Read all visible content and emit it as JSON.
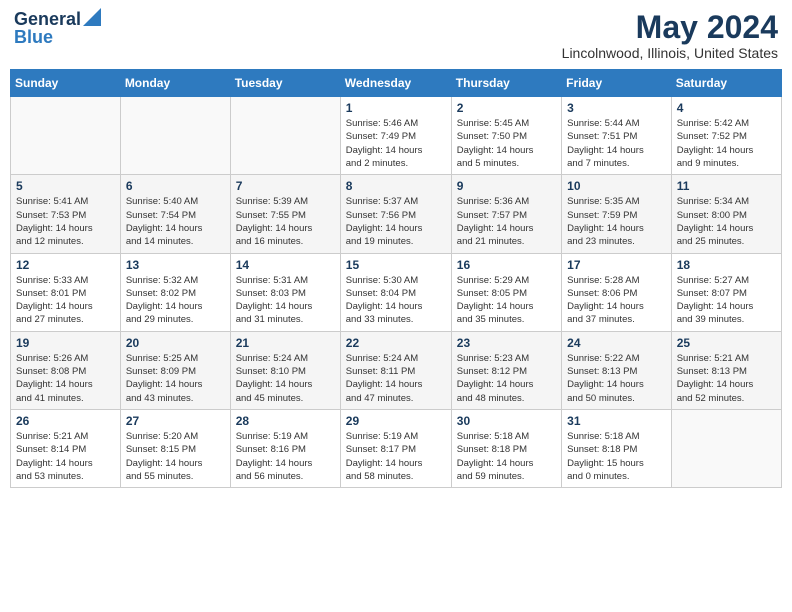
{
  "header": {
    "logo_general": "General",
    "logo_blue": "Blue",
    "month": "May 2024",
    "location": "Lincolnwood, Illinois, United States"
  },
  "days_of_week": [
    "Sunday",
    "Monday",
    "Tuesday",
    "Wednesday",
    "Thursday",
    "Friday",
    "Saturday"
  ],
  "weeks": [
    [
      {
        "day": "",
        "info": ""
      },
      {
        "day": "",
        "info": ""
      },
      {
        "day": "",
        "info": ""
      },
      {
        "day": "1",
        "info": "Sunrise: 5:46 AM\nSunset: 7:49 PM\nDaylight: 14 hours\nand 2 minutes."
      },
      {
        "day": "2",
        "info": "Sunrise: 5:45 AM\nSunset: 7:50 PM\nDaylight: 14 hours\nand 5 minutes."
      },
      {
        "day": "3",
        "info": "Sunrise: 5:44 AM\nSunset: 7:51 PM\nDaylight: 14 hours\nand 7 minutes."
      },
      {
        "day": "4",
        "info": "Sunrise: 5:42 AM\nSunset: 7:52 PM\nDaylight: 14 hours\nand 9 minutes."
      }
    ],
    [
      {
        "day": "5",
        "info": "Sunrise: 5:41 AM\nSunset: 7:53 PM\nDaylight: 14 hours\nand 12 minutes."
      },
      {
        "day": "6",
        "info": "Sunrise: 5:40 AM\nSunset: 7:54 PM\nDaylight: 14 hours\nand 14 minutes."
      },
      {
        "day": "7",
        "info": "Sunrise: 5:39 AM\nSunset: 7:55 PM\nDaylight: 14 hours\nand 16 minutes."
      },
      {
        "day": "8",
        "info": "Sunrise: 5:37 AM\nSunset: 7:56 PM\nDaylight: 14 hours\nand 19 minutes."
      },
      {
        "day": "9",
        "info": "Sunrise: 5:36 AM\nSunset: 7:57 PM\nDaylight: 14 hours\nand 21 minutes."
      },
      {
        "day": "10",
        "info": "Sunrise: 5:35 AM\nSunset: 7:59 PM\nDaylight: 14 hours\nand 23 minutes."
      },
      {
        "day": "11",
        "info": "Sunrise: 5:34 AM\nSunset: 8:00 PM\nDaylight: 14 hours\nand 25 minutes."
      }
    ],
    [
      {
        "day": "12",
        "info": "Sunrise: 5:33 AM\nSunset: 8:01 PM\nDaylight: 14 hours\nand 27 minutes."
      },
      {
        "day": "13",
        "info": "Sunrise: 5:32 AM\nSunset: 8:02 PM\nDaylight: 14 hours\nand 29 minutes."
      },
      {
        "day": "14",
        "info": "Sunrise: 5:31 AM\nSunset: 8:03 PM\nDaylight: 14 hours\nand 31 minutes."
      },
      {
        "day": "15",
        "info": "Sunrise: 5:30 AM\nSunset: 8:04 PM\nDaylight: 14 hours\nand 33 minutes."
      },
      {
        "day": "16",
        "info": "Sunrise: 5:29 AM\nSunset: 8:05 PM\nDaylight: 14 hours\nand 35 minutes."
      },
      {
        "day": "17",
        "info": "Sunrise: 5:28 AM\nSunset: 8:06 PM\nDaylight: 14 hours\nand 37 minutes."
      },
      {
        "day": "18",
        "info": "Sunrise: 5:27 AM\nSunset: 8:07 PM\nDaylight: 14 hours\nand 39 minutes."
      }
    ],
    [
      {
        "day": "19",
        "info": "Sunrise: 5:26 AM\nSunset: 8:08 PM\nDaylight: 14 hours\nand 41 minutes."
      },
      {
        "day": "20",
        "info": "Sunrise: 5:25 AM\nSunset: 8:09 PM\nDaylight: 14 hours\nand 43 minutes."
      },
      {
        "day": "21",
        "info": "Sunrise: 5:24 AM\nSunset: 8:10 PM\nDaylight: 14 hours\nand 45 minutes."
      },
      {
        "day": "22",
        "info": "Sunrise: 5:24 AM\nSunset: 8:11 PM\nDaylight: 14 hours\nand 47 minutes."
      },
      {
        "day": "23",
        "info": "Sunrise: 5:23 AM\nSunset: 8:12 PM\nDaylight: 14 hours\nand 48 minutes."
      },
      {
        "day": "24",
        "info": "Sunrise: 5:22 AM\nSunset: 8:13 PM\nDaylight: 14 hours\nand 50 minutes."
      },
      {
        "day": "25",
        "info": "Sunrise: 5:21 AM\nSunset: 8:13 PM\nDaylight: 14 hours\nand 52 minutes."
      }
    ],
    [
      {
        "day": "26",
        "info": "Sunrise: 5:21 AM\nSunset: 8:14 PM\nDaylight: 14 hours\nand 53 minutes."
      },
      {
        "day": "27",
        "info": "Sunrise: 5:20 AM\nSunset: 8:15 PM\nDaylight: 14 hours\nand 55 minutes."
      },
      {
        "day": "28",
        "info": "Sunrise: 5:19 AM\nSunset: 8:16 PM\nDaylight: 14 hours\nand 56 minutes."
      },
      {
        "day": "29",
        "info": "Sunrise: 5:19 AM\nSunset: 8:17 PM\nDaylight: 14 hours\nand 58 minutes."
      },
      {
        "day": "30",
        "info": "Sunrise: 5:18 AM\nSunset: 8:18 PM\nDaylight: 14 hours\nand 59 minutes."
      },
      {
        "day": "31",
        "info": "Sunrise: 5:18 AM\nSunset: 8:18 PM\nDaylight: 15 hours\nand 0 minutes."
      },
      {
        "day": "",
        "info": ""
      }
    ]
  ]
}
